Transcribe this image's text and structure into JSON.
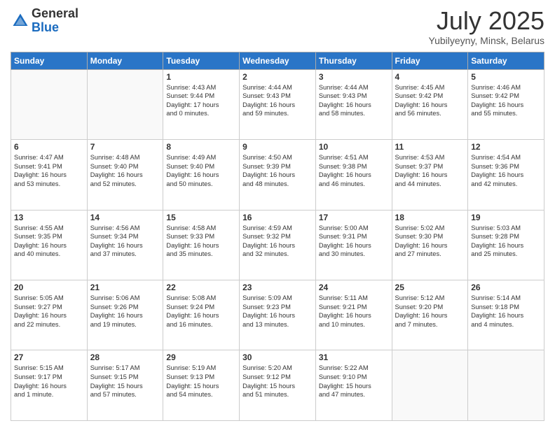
{
  "logo": {
    "general": "General",
    "blue": "Blue"
  },
  "header": {
    "month": "July 2025",
    "location": "Yubilyeyny, Minsk, Belarus"
  },
  "days_of_week": [
    "Sunday",
    "Monday",
    "Tuesday",
    "Wednesday",
    "Thursday",
    "Friday",
    "Saturday"
  ],
  "weeks": [
    [
      {
        "day": "",
        "content": ""
      },
      {
        "day": "",
        "content": ""
      },
      {
        "day": "1",
        "content": "Sunrise: 4:43 AM\nSunset: 9:44 PM\nDaylight: 17 hours\nand 0 minutes."
      },
      {
        "day": "2",
        "content": "Sunrise: 4:44 AM\nSunset: 9:43 PM\nDaylight: 16 hours\nand 59 minutes."
      },
      {
        "day": "3",
        "content": "Sunrise: 4:44 AM\nSunset: 9:43 PM\nDaylight: 16 hours\nand 58 minutes."
      },
      {
        "day": "4",
        "content": "Sunrise: 4:45 AM\nSunset: 9:42 PM\nDaylight: 16 hours\nand 56 minutes."
      },
      {
        "day": "5",
        "content": "Sunrise: 4:46 AM\nSunset: 9:42 PM\nDaylight: 16 hours\nand 55 minutes."
      }
    ],
    [
      {
        "day": "6",
        "content": "Sunrise: 4:47 AM\nSunset: 9:41 PM\nDaylight: 16 hours\nand 53 minutes."
      },
      {
        "day": "7",
        "content": "Sunrise: 4:48 AM\nSunset: 9:40 PM\nDaylight: 16 hours\nand 52 minutes."
      },
      {
        "day": "8",
        "content": "Sunrise: 4:49 AM\nSunset: 9:40 PM\nDaylight: 16 hours\nand 50 minutes."
      },
      {
        "day": "9",
        "content": "Sunrise: 4:50 AM\nSunset: 9:39 PM\nDaylight: 16 hours\nand 48 minutes."
      },
      {
        "day": "10",
        "content": "Sunrise: 4:51 AM\nSunset: 9:38 PM\nDaylight: 16 hours\nand 46 minutes."
      },
      {
        "day": "11",
        "content": "Sunrise: 4:53 AM\nSunset: 9:37 PM\nDaylight: 16 hours\nand 44 minutes."
      },
      {
        "day": "12",
        "content": "Sunrise: 4:54 AM\nSunset: 9:36 PM\nDaylight: 16 hours\nand 42 minutes."
      }
    ],
    [
      {
        "day": "13",
        "content": "Sunrise: 4:55 AM\nSunset: 9:35 PM\nDaylight: 16 hours\nand 40 minutes."
      },
      {
        "day": "14",
        "content": "Sunrise: 4:56 AM\nSunset: 9:34 PM\nDaylight: 16 hours\nand 37 minutes."
      },
      {
        "day": "15",
        "content": "Sunrise: 4:58 AM\nSunset: 9:33 PM\nDaylight: 16 hours\nand 35 minutes."
      },
      {
        "day": "16",
        "content": "Sunrise: 4:59 AM\nSunset: 9:32 PM\nDaylight: 16 hours\nand 32 minutes."
      },
      {
        "day": "17",
        "content": "Sunrise: 5:00 AM\nSunset: 9:31 PM\nDaylight: 16 hours\nand 30 minutes."
      },
      {
        "day": "18",
        "content": "Sunrise: 5:02 AM\nSunset: 9:30 PM\nDaylight: 16 hours\nand 27 minutes."
      },
      {
        "day": "19",
        "content": "Sunrise: 5:03 AM\nSunset: 9:28 PM\nDaylight: 16 hours\nand 25 minutes."
      }
    ],
    [
      {
        "day": "20",
        "content": "Sunrise: 5:05 AM\nSunset: 9:27 PM\nDaylight: 16 hours\nand 22 minutes."
      },
      {
        "day": "21",
        "content": "Sunrise: 5:06 AM\nSunset: 9:26 PM\nDaylight: 16 hours\nand 19 minutes."
      },
      {
        "day": "22",
        "content": "Sunrise: 5:08 AM\nSunset: 9:24 PM\nDaylight: 16 hours\nand 16 minutes."
      },
      {
        "day": "23",
        "content": "Sunrise: 5:09 AM\nSunset: 9:23 PM\nDaylight: 16 hours\nand 13 minutes."
      },
      {
        "day": "24",
        "content": "Sunrise: 5:11 AM\nSunset: 9:21 PM\nDaylight: 16 hours\nand 10 minutes."
      },
      {
        "day": "25",
        "content": "Sunrise: 5:12 AM\nSunset: 9:20 PM\nDaylight: 16 hours\nand 7 minutes."
      },
      {
        "day": "26",
        "content": "Sunrise: 5:14 AM\nSunset: 9:18 PM\nDaylight: 16 hours\nand 4 minutes."
      }
    ],
    [
      {
        "day": "27",
        "content": "Sunrise: 5:15 AM\nSunset: 9:17 PM\nDaylight: 16 hours\nand 1 minute."
      },
      {
        "day": "28",
        "content": "Sunrise: 5:17 AM\nSunset: 9:15 PM\nDaylight: 15 hours\nand 57 minutes."
      },
      {
        "day": "29",
        "content": "Sunrise: 5:19 AM\nSunset: 9:13 PM\nDaylight: 15 hours\nand 54 minutes."
      },
      {
        "day": "30",
        "content": "Sunrise: 5:20 AM\nSunset: 9:12 PM\nDaylight: 15 hours\nand 51 minutes."
      },
      {
        "day": "31",
        "content": "Sunrise: 5:22 AM\nSunset: 9:10 PM\nDaylight: 15 hours\nand 47 minutes."
      },
      {
        "day": "",
        "content": ""
      },
      {
        "day": "",
        "content": ""
      }
    ]
  ]
}
